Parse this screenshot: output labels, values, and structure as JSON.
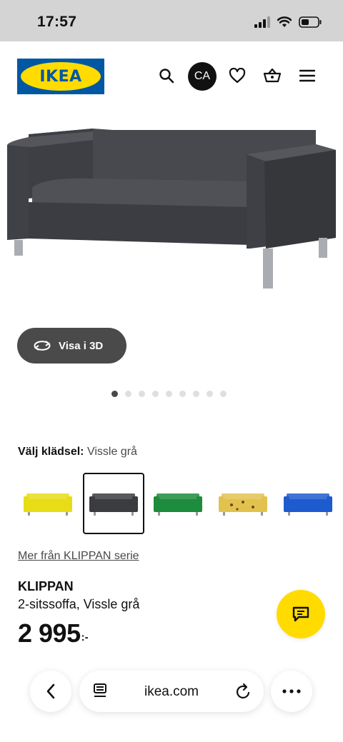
{
  "status_bar": {
    "time": "17:57"
  },
  "header": {
    "logo_text": "IKEA",
    "avatar_initials": "CA",
    "icons": [
      "search-icon",
      "heart-icon",
      "basket-icon",
      "menu-icon"
    ]
  },
  "gallery": {
    "view_3d_label": "Visa i 3D",
    "dot_count": 9,
    "active_index": 0
  },
  "fabric": {
    "label": "Välj klädsel:",
    "value": "Vissle grå",
    "swatches": [
      {
        "color": "#e7dc16",
        "selected": false
      },
      {
        "color": "#3b3c40",
        "selected": true
      },
      {
        "color": "#1d8c3c",
        "selected": false
      },
      {
        "color": "#e2c24e",
        "selected": false
      },
      {
        "color": "#1d5bcf",
        "selected": false
      }
    ]
  },
  "series_link": "Mer från KLIPPAN serie",
  "product": {
    "name": "KLIPPAN",
    "description": "2-sitssoffa, Vissle grå",
    "price": "2 995",
    "currency_suffix": ":-"
  },
  "colors": {
    "ikea_blue": "#0058a3",
    "ikea_yellow": "#ffdb00"
  },
  "browser": {
    "url": "ikea.com"
  }
}
